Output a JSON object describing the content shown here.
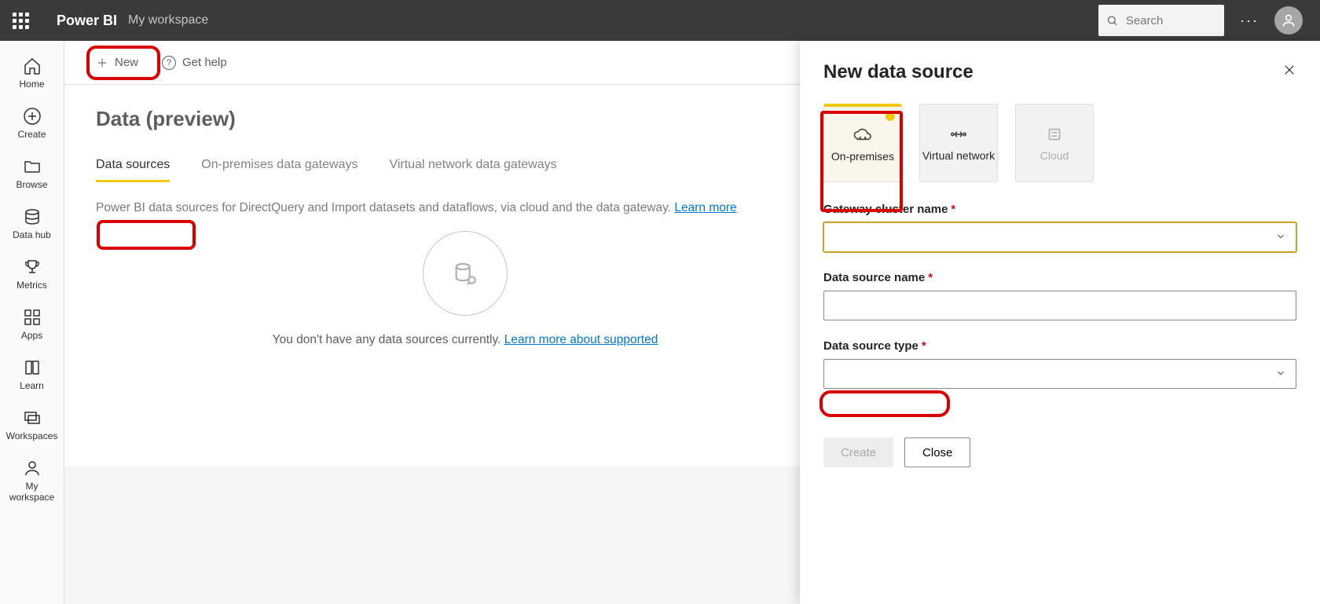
{
  "top": {
    "brand": "Power BI",
    "subtitle": "My workspace",
    "search_placeholder": "Search"
  },
  "rail": [
    {
      "label": "Home"
    },
    {
      "label": "Create"
    },
    {
      "label": "Browse"
    },
    {
      "label": "Data hub"
    },
    {
      "label": "Metrics"
    },
    {
      "label": "Apps"
    },
    {
      "label": "Learn"
    },
    {
      "label": "Workspaces"
    },
    {
      "label": "My workspace"
    }
  ],
  "toolbar": {
    "new_label": "New",
    "help_label": "Get help"
  },
  "page": {
    "title": "Data (preview)",
    "tabs": {
      "sources": "Data sources",
      "onprem": "On-premises data gateways",
      "vnet": "Virtual network data gateways"
    },
    "desc_prefix": "Power BI data sources for DirectQuery and Import datasets and dataflows, via cloud and the data gateway. ",
    "desc_link": "Learn more",
    "empty_text_prefix": "You don't have any data sources currently. ",
    "empty_link": "Learn more about supported"
  },
  "panel": {
    "title": "New data source",
    "types": {
      "onprem": "On-premises",
      "virtual": "Virtual network",
      "cloud": "Cloud"
    },
    "fields": {
      "gateway": "Gateway cluster name",
      "dsname": "Data source name",
      "dstype": "Data source type"
    },
    "buttons": {
      "create": "Create",
      "close": "Close"
    }
  }
}
